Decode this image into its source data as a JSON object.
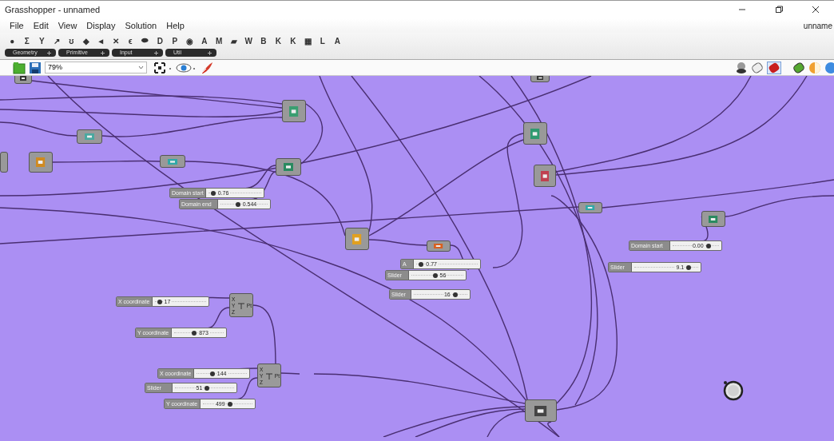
{
  "window": {
    "title": "Grasshopper - unnamed",
    "document_tab": "unname"
  },
  "menu": [
    "File",
    "Edit",
    "View",
    "Display",
    "Solution",
    "Help"
  ],
  "component_tabs": [
    "●",
    "Σ",
    "Y",
    "↗",
    "ʊ",
    "◆",
    "◄",
    "✕",
    "ϵ",
    "⬬",
    "D",
    "P",
    "◉",
    "A",
    "M",
    "▰",
    "W",
    "B",
    "K",
    "K",
    "▦",
    "L",
    "A"
  ],
  "panels": [
    "Geometry",
    "Primitive",
    "Input",
    "Util"
  ],
  "toolbar": {
    "zoom": "79%"
  },
  "canvas": {
    "sliders": [
      {
        "label": "Domain start",
        "value": "0.76",
        "level": 0.05
      },
      {
        "label": "Domain end",
        "value": "0.544",
        "level": 0.35
      },
      {
        "label": "A",
        "value": "0.77",
        "level": 0.05
      },
      {
        "label": "Slider",
        "value": "56",
        "level": 0.45
      },
      {
        "label": "Slider",
        "value": "16",
        "level": 0.8
      },
      {
        "label": "Domain start",
        "value": "0.00",
        "level": 0.8
      },
      {
        "label": "Slider",
        "value": "9.1",
        "level": 0.88
      },
      {
        "label": "X coordinate",
        "value": "17",
        "level": 0.05
      },
      {
        "label": "Y coordinate",
        "value": "873",
        "level": 0.4
      },
      {
        "label": "X coordinate",
        "value": "144",
        "level": 0.3
      },
      {
        "label": "Slider",
        "value": "51",
        "level": 0.55
      },
      {
        "label": "Y coordinate",
        "value": "499",
        "level": 0.55
      }
    ],
    "points": [
      {
        "inputs": [
          "X",
          "Y",
          "Z"
        ],
        "output": "Pt"
      },
      {
        "inputs": [
          "X",
          "Y",
          "Z"
        ],
        "output": "Pt"
      }
    ]
  }
}
